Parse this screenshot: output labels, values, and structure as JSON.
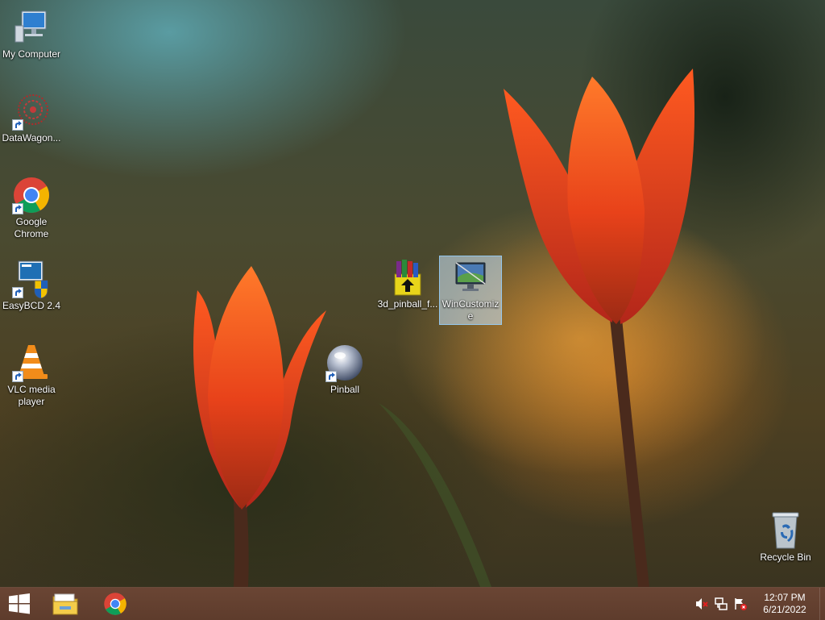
{
  "desktop": {
    "icons": [
      {
        "label": "My Computer",
        "icon": "computer-icon",
        "shortcut": false
      },
      {
        "label": "DataWagon...",
        "icon": "datawagon-icon",
        "shortcut": true
      },
      {
        "label": "Google Chrome",
        "icon": "chrome-icon",
        "shortcut": true
      },
      {
        "label": "EasyBCD 2.4",
        "icon": "easybcd-icon",
        "shortcut": true
      },
      {
        "label": "VLC media player",
        "icon": "vlc-icon",
        "shortcut": true
      },
      {
        "label": "Pinball",
        "icon": "pinball-icon",
        "shortcut": true
      },
      {
        "label": "3d_pinball_f...",
        "icon": "winrar-archive-icon",
        "shortcut": false
      },
      {
        "label": "WinCustomize",
        "icon": "wincustomize-icon",
        "shortcut": false,
        "selected": true
      },
      {
        "label": "Recycle Bin",
        "icon": "recycle-bin-icon",
        "shortcut": false
      }
    ]
  },
  "taskbar": {
    "start": {
      "icon": "windows-start-icon"
    },
    "pinned": [
      {
        "name": "File Explorer",
        "icon": "file-explorer-icon"
      },
      {
        "name": "Google Chrome",
        "icon": "chrome-icon"
      }
    ],
    "tray": {
      "icons": [
        "volume-muted-icon",
        "network-icon",
        "action-center-icon"
      ],
      "time": "12:07 PM",
      "date": "6/21/2022"
    }
  },
  "colors": {
    "taskbar": "#5e3c2c",
    "selection": "#cce8ff",
    "tulip": "#e84a18"
  }
}
